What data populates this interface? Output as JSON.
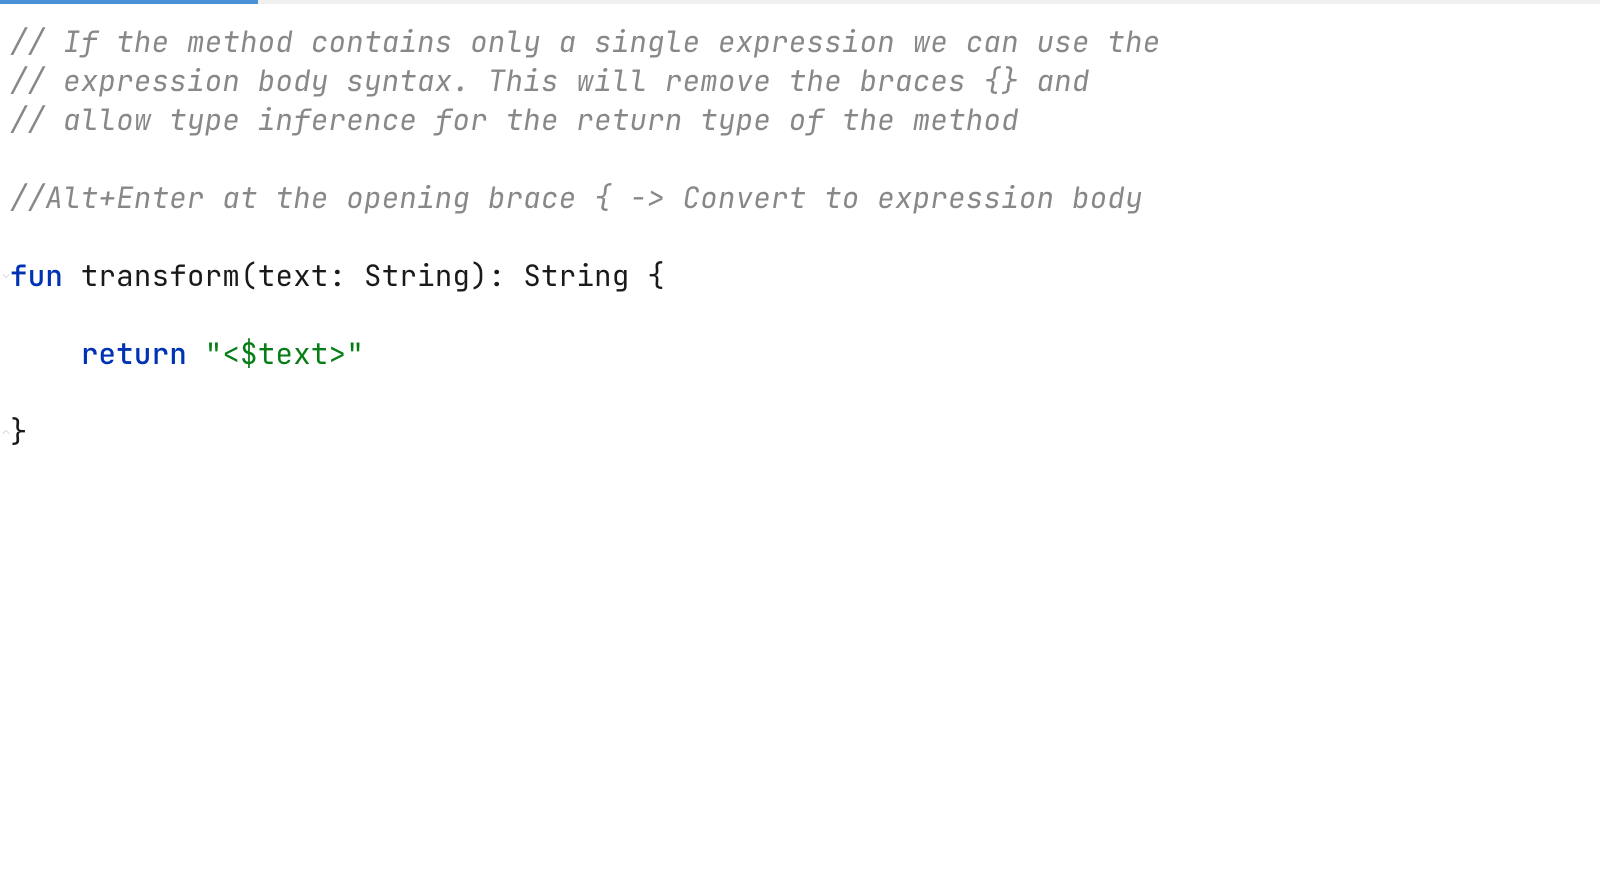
{
  "editor": {
    "lines": {
      "comment1": "// If the method contains only a single expression we can use the",
      "comment2": "// expression body syntax. This will remove the braces {} and",
      "comment3": "// allow type inference for the return type of the method",
      "comment4": "//Alt+Enter at the opening brace { -> Convert to expression body",
      "funKw": "fun",
      "funcName": "transform",
      "paramName": "text",
      "paramType": "String",
      "returnType": "String",
      "openBrace": "{",
      "indent": "    ",
      "returnKw": "return",
      "stringOpen": "\"<",
      "templateExpr": "$text",
      "stringClose": ">\"",
      "closeBrace": "}"
    }
  },
  "ui": {
    "progressPercent": 16
  }
}
